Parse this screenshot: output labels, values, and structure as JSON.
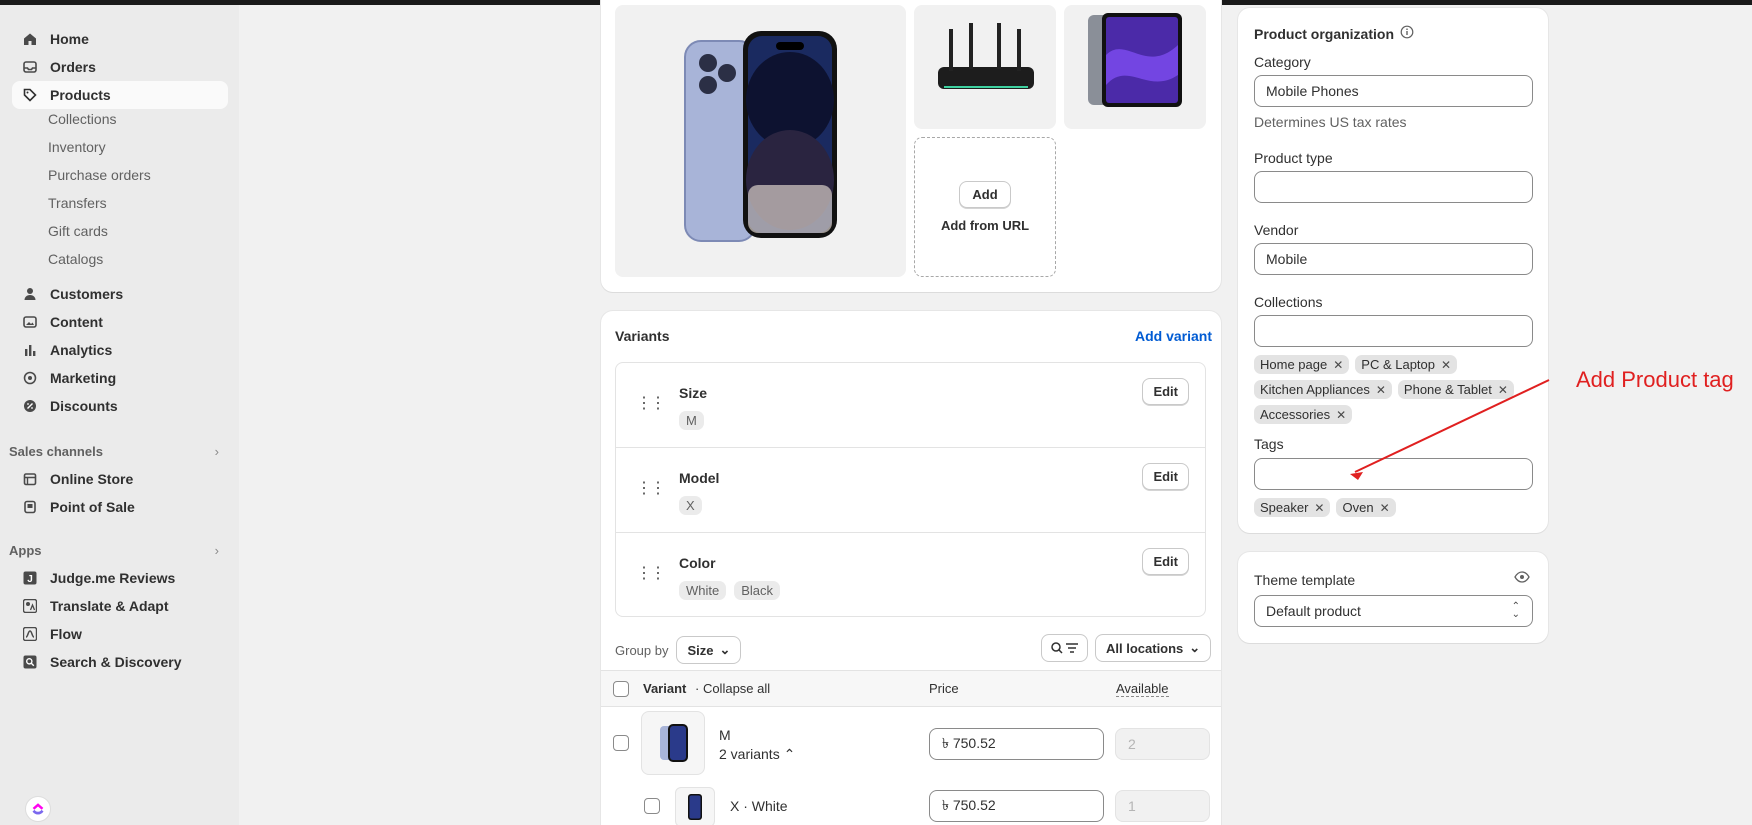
{
  "sidebar": {
    "items": [
      {
        "label": "Home",
        "icon": "home-icon"
      },
      {
        "label": "Orders",
        "icon": "inbox-icon"
      },
      {
        "label": "Products",
        "icon": "tag-icon",
        "active": true
      },
      {
        "label": "Customers",
        "icon": "person-icon"
      },
      {
        "label": "Content",
        "icon": "image-icon"
      },
      {
        "label": "Analytics",
        "icon": "bar-chart-icon"
      },
      {
        "label": "Marketing",
        "icon": "target-icon"
      },
      {
        "label": "Discounts",
        "icon": "discount-icon"
      }
    ],
    "product_subitems": [
      "Collections",
      "Inventory",
      "Purchase orders",
      "Transfers",
      "Gift cards",
      "Catalogs"
    ],
    "sales_channels": {
      "title": "Sales channels",
      "items": [
        {
          "label": "Online Store",
          "icon": "store-icon"
        },
        {
          "label": "Point of Sale",
          "icon": "pos-icon"
        }
      ]
    },
    "apps": {
      "title": "Apps",
      "items": [
        {
          "label": "Judge.me Reviews",
          "icon": "judgeme-icon"
        },
        {
          "label": "Translate & Adapt",
          "icon": "translate-icon"
        },
        {
          "label": "Flow",
          "icon": "flow-icon"
        },
        {
          "label": "Search & Discovery",
          "icon": "search-icon"
        }
      ]
    }
  },
  "media": {
    "add_button": "Add",
    "add_url": "Add from URL"
  },
  "variants": {
    "title": "Variants",
    "add_variant": "Add variant",
    "options": [
      {
        "name": "Size",
        "values": [
          "M"
        ],
        "edit": "Edit"
      },
      {
        "name": "Model",
        "values": [
          "X"
        ],
        "edit": "Edit"
      },
      {
        "name": "Color",
        "values": [
          "White",
          "Black"
        ],
        "edit": "Edit"
      }
    ],
    "group_by_label": "Group by",
    "group_by_value": "Size",
    "locations": "All locations",
    "table": {
      "col_variant": "Variant",
      "collapse_all": "· Collapse all",
      "col_price": "Price",
      "col_available": "Available"
    },
    "rows": [
      {
        "name": "M",
        "sub": "2 variants",
        "price": "৳ 750.52",
        "available": "2"
      },
      {
        "name": "X · White",
        "price": "৳ 750.52",
        "available": "1"
      }
    ]
  },
  "organization": {
    "title": "Product organization",
    "category_label": "Category",
    "category_value": "Mobile Phones",
    "category_help": "Determines US tax rates",
    "type_label": "Product type",
    "type_value": "",
    "vendor_label": "Vendor",
    "vendor_value": "Mobile",
    "collections_label": "Collections",
    "collections_value": "",
    "collections": [
      "Home page",
      "PC & Laptop",
      "Kitchen Appliances",
      "Phone & Tablet",
      "Accessories"
    ],
    "tags_label": "Tags",
    "tags_value": "",
    "tags": [
      "Speaker",
      "Oven"
    ]
  },
  "theme": {
    "label": "Theme template",
    "value": "Default product"
  },
  "annotation": {
    "text": "Add Product tag",
    "color": "#e02020"
  }
}
